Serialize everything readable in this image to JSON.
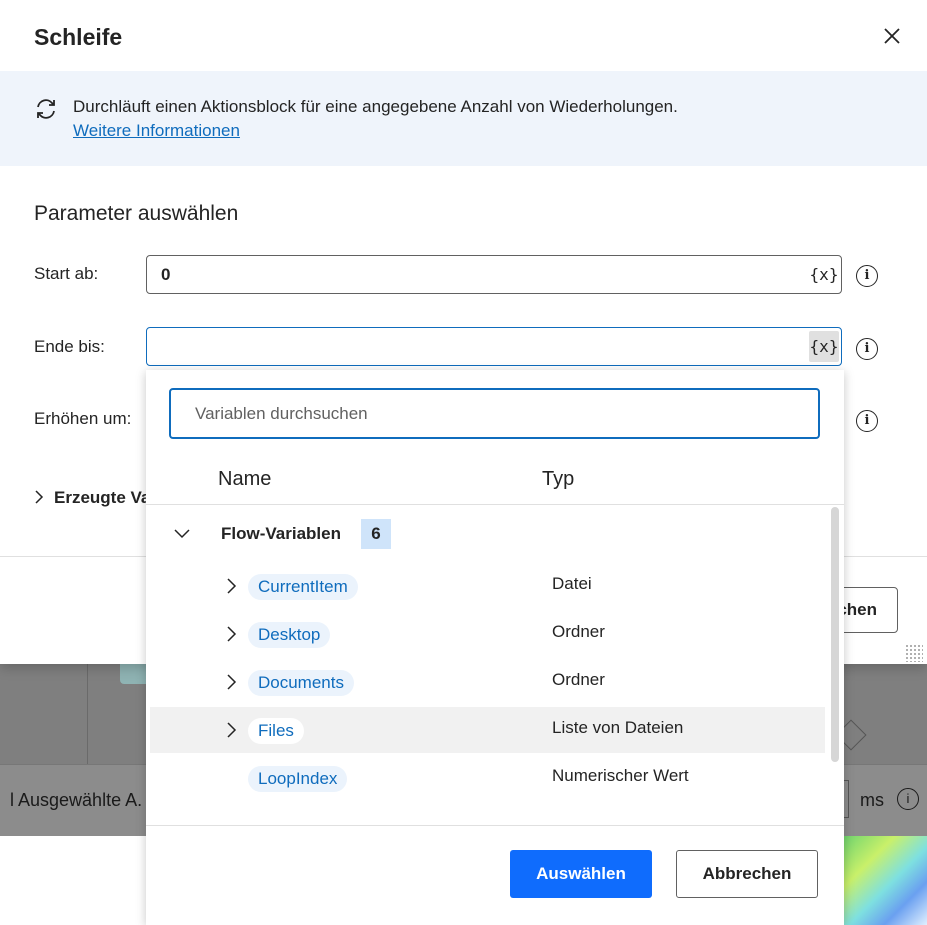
{
  "dialog": {
    "title": "Schleife",
    "description": "Durchläuft einen Aktionsblock für eine angegebene Anzahl von Wiederholungen.",
    "more_info_link": "Weitere Informationen",
    "section_title": "Parameter auswählen",
    "fields": {
      "start": {
        "label": "Start ab:",
        "value": "0"
      },
      "end": {
        "label": "Ende bis:",
        "value": ""
      },
      "step": {
        "label": "Erhöhen um:"
      }
    },
    "var_button": "{x}",
    "info_glyph": "i",
    "generated_vars_label": "Erzeugte Va",
    "footer_button_partial": "chen"
  },
  "popup": {
    "search_placeholder": "Variablen durchsuchen",
    "columns": {
      "name": "Name",
      "type": "Typ"
    },
    "group": {
      "label": "Flow-Variablen",
      "count": "6"
    },
    "rows": [
      {
        "name": "CurrentItem",
        "type": "Datei",
        "expandable": true
      },
      {
        "name": "Desktop",
        "type": "Ordner",
        "expandable": true
      },
      {
        "name": "Documents",
        "type": "Ordner",
        "expandable": true
      },
      {
        "name": "Files",
        "type": "Liste von Dateien",
        "expandable": true,
        "highlighted": true
      },
      {
        "name": "LoopIndex",
        "type": "Numerischer Wert",
        "expandable": false
      }
    ],
    "select_button": "Auswählen",
    "cancel_button": "Abbrechen"
  },
  "background": {
    "status_text": "l Ausgewählte A.",
    "unit": "ms"
  },
  "colors": {
    "accent": "#0f6cbd",
    "primary_button": "#0f6cfd",
    "banner_bg": "#eff4fb",
    "pill_bg": "#ebf3fc",
    "count_bg": "#cfe4fa"
  },
  "icons": {
    "close": "close-icon",
    "loop": "loop-icon",
    "info": "info-icon",
    "chevron_right": "chevron-right-icon",
    "chevron_down": "chevron-down-icon"
  }
}
